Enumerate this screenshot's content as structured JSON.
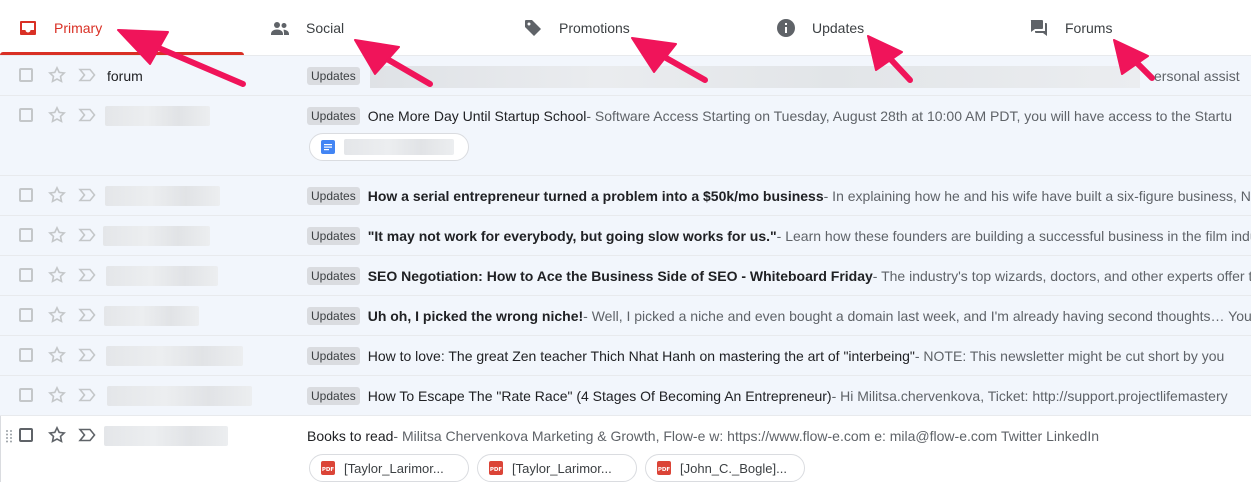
{
  "tabs": [
    {
      "label": "Primary",
      "icon": "inbox-icon",
      "active": true
    },
    {
      "label": "Social",
      "icon": "people-icon"
    },
    {
      "label": "Promotions",
      "icon": "tag-icon"
    },
    {
      "label": "Updates",
      "icon": "info-icon"
    },
    {
      "label": "Forums",
      "icon": "forum-icon"
    }
  ],
  "colors": {
    "accent": "#d93025",
    "annotation_arrow": "#f0145a",
    "pdf_red": "#db4437",
    "doc_blue": "#4285f4"
  },
  "rows": [
    {
      "sender": "forum",
      "label": "Updates",
      "snippet_tail": "ersonal assist"
    },
    {
      "label": "Updates",
      "subject": "One More Day Until Startup School",
      "snippet": " - Software Access Starting on Tuesday, August 28th at 10:00 AM PDT, you will have access to the Startu"
    },
    {
      "label": "Updates",
      "subject": "How a serial entrepreneur turned a problem into a $50k/mo business",
      "snippet": " - In explaining how he and his wife have built a six-figure business, N"
    },
    {
      "label": "Updates",
      "subject": "\"It may not work for everybody, but going slow works for us.\"",
      "snippet": " - Learn how these founders are building a successful business in the film indu"
    },
    {
      "label": "Updates",
      "subject": "SEO Negotiation: How to Ace the Business Side of SEO - Whiteboard Friday",
      "snippet": " - The industry's top wizards, doctors, and other experts offer th"
    },
    {
      "label": "Updates",
      "subject": "Uh oh, I picked the wrong niche!",
      "snippet": " - Well, I picked a niche and even bought a domain last week, and I'm already having second thoughts… You"
    },
    {
      "label": "Updates",
      "subject": "How to love: The great Zen teacher Thich Nhat Hanh on mastering the art of \"interbeing\"",
      "snippet": "  - NOTE: This newsletter might be cut short by you"
    },
    {
      "label": "Updates",
      "subject": "How To Escape The \"Rate Race\" (4 Stages Of Becoming An Entrepreneur)",
      "snippet": " - Hi Militsa.chervenkova, Ticket: http://support.projectlifemastery"
    },
    {
      "subject": "Books to read",
      "snippet": " - Militsa Chervenkova Marketing & Growth, Flow-e w: https://www.flow-e.com e: mila@flow-e.com Twitter LinkedIn"
    }
  ],
  "attachments": [
    "[Taylor_Larimor...",
    "[Taylor_Larimor...",
    "[John_C._Bogle]..."
  ]
}
